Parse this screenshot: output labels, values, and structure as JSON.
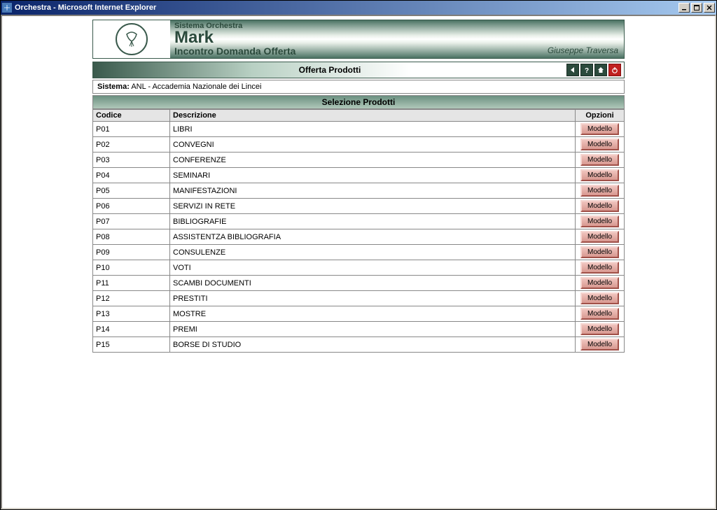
{
  "window": {
    "title": "Orchestra - Microsoft Internet Explorer"
  },
  "header": {
    "small_line": "Sistema Orchestra",
    "big_line": "Mark",
    "sub_line": "Incontro Domanda Offerta",
    "user": "Giuseppe Traversa"
  },
  "section_bar": {
    "title": "Offerta Prodotti"
  },
  "sistema": {
    "label": "Sistema:",
    "value": "  ANL - Accademia Nazionale dei Lincei"
  },
  "selezione": {
    "title": "Selezione Prodotti"
  },
  "columns": {
    "codice": "Codice",
    "descrizione": "Descrizione",
    "opzioni": "Opzioni"
  },
  "button_label": "Modello",
  "products": [
    {
      "codice": "P01",
      "descrizione": "LIBRI"
    },
    {
      "codice": "P02",
      "descrizione": "CONVEGNI"
    },
    {
      "codice": "P03",
      "descrizione": "CONFERENZE"
    },
    {
      "codice": "P04",
      "descrizione": "SEMINARI"
    },
    {
      "codice": "P05",
      "descrizione": "MANIFESTAZIONI"
    },
    {
      "codice": "P06",
      "descrizione": "SERVIZI IN RETE"
    },
    {
      "codice": "P07",
      "descrizione": "BIBLIOGRAFIE"
    },
    {
      "codice": "P08",
      "descrizione": "ASSISTENTZA BIBLIOGRAFIA"
    },
    {
      "codice": "P09",
      "descrizione": "CONSULENZE"
    },
    {
      "codice": "P10",
      "descrizione": "VOTI"
    },
    {
      "codice": "P11",
      "descrizione": "SCAMBI DOCUMENTI"
    },
    {
      "codice": "P12",
      "descrizione": "PRESTITI"
    },
    {
      "codice": "P13",
      "descrizione": "MOSTRE"
    },
    {
      "codice": "P14",
      "descrizione": "PREMI"
    },
    {
      "codice": "P15",
      "descrizione": "BORSE DI STUDIO"
    }
  ]
}
